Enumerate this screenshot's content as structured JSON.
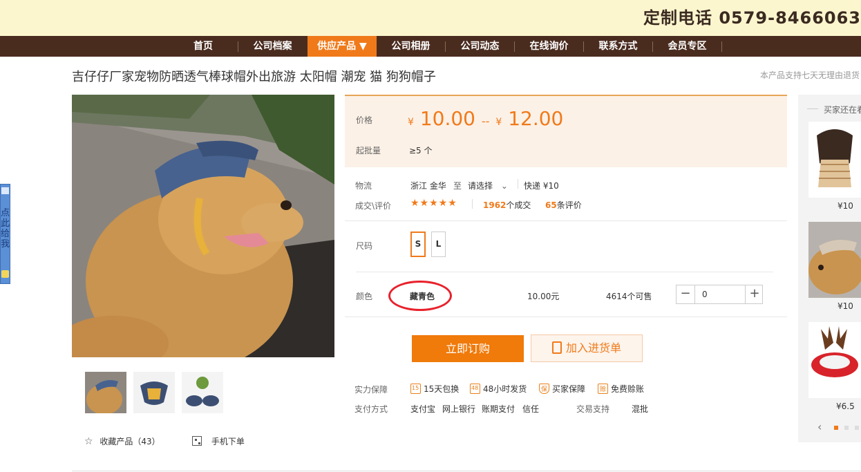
{
  "banner": {
    "hotline": "定制电话 0579-8466063"
  },
  "nav": {
    "items": [
      {
        "label": "首页"
      },
      {
        "label": "公司档案"
      },
      {
        "label": "供应产品 ▼"
      },
      {
        "label": "公司相册"
      },
      {
        "label": "公司动态"
      },
      {
        "label": "在线询价"
      },
      {
        "label": "联系方式"
      },
      {
        "label": "会员专区"
      }
    ],
    "active_index": 2
  },
  "product": {
    "title": "吉仔仔厂家宠物防晒透气棒球帽外出旅游 太阳帽 潮宠 猫 狗狗帽子",
    "return_notice": "本产品支持七天无理由退货"
  },
  "left_tab": {
    "text": "点此给我"
  },
  "price": {
    "label": "价格",
    "currency": "¥",
    "min": "10.00",
    "separator": "--",
    "max": "12.00",
    "moq_label": "起批量",
    "moq": "≥5 个"
  },
  "logistics": {
    "label": "物流",
    "from": "浙江 金华",
    "to_word": "至",
    "dest": "请选择",
    "express": "快递 ¥10"
  },
  "deals": {
    "label": "成交\\评价",
    "stars": "★★★★★",
    "sold_count": "1962",
    "sold_suffix": "个成交",
    "review_count": "65",
    "review_suffix": "条评价"
  },
  "size": {
    "label": "尺码",
    "options": [
      "S",
      "L"
    ],
    "selected": "S"
  },
  "color": {
    "label": "颜色",
    "value": "藏青色",
    "price": "10.00元",
    "stock": "4614个可售",
    "qty": "0",
    "minus": "−",
    "plus": "+"
  },
  "actions": {
    "buy": "立即订购",
    "cart": "加入进货单"
  },
  "guarantee": {
    "label": "实力保障",
    "items": [
      "15天包换",
      "48小时发货",
      "买家保障",
      "免费赊账"
    ],
    "icon_marks": [
      "15",
      "48",
      "保",
      "赊"
    ]
  },
  "payment": {
    "label": "支付方式",
    "methods": [
      "支付宝",
      "网上银行",
      "账期支付",
      "信任"
    ],
    "trade_label": "交易支持",
    "trade_value": "混批"
  },
  "footer_actions": {
    "favorite": "收藏产品（43）",
    "mobile": "手机下单"
  },
  "recommend": {
    "title": "买家还在看",
    "items": [
      {
        "price": "¥10"
      },
      {
        "price": "¥10"
      },
      {
        "price": "¥6.5"
      }
    ]
  },
  "colors": {
    "accent": "#f07a1a",
    "nav_bg": "#4a2c1f",
    "banner_bg": "#fcf6cf",
    "annotation": "#e8212b"
  }
}
